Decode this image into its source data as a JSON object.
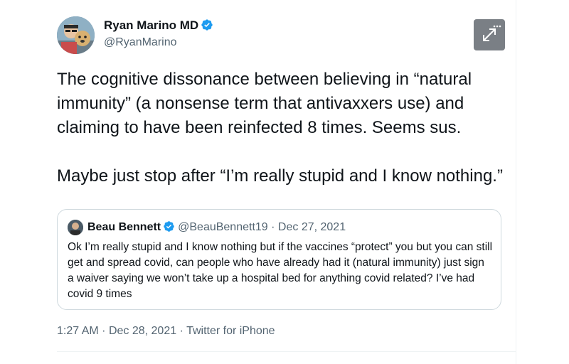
{
  "author": {
    "name": "Ryan Marino MD",
    "handle": "@RyanMarino"
  },
  "tweet": {
    "text": "The cognitive dissonance between believing in “natural immunity” (a nonsense term that antivaxxers use) and claiming to have been reinfected 8 times. Seems sus.\n\nMaybe just stop after “I’m really stupid and I know nothing.”"
  },
  "quoted": {
    "name": "Beau Bennett",
    "handle": "@BeauBennett19",
    "separator": "·",
    "date": "Dec 27, 2021",
    "text": "Ok I’m really stupid and I know nothing but if the vaccines “protect” you but you can still get and spread covid, can people who have already had it (natural immunity) just sign a waiver saying we won’t take up a hospital bed for anything covid related? I’ve had covid 9 times"
  },
  "meta": {
    "time": "1:27 AM",
    "separator": "·",
    "date": "Dec 28, 2021",
    "source": "Twitter for iPhone"
  },
  "icons": {
    "verified": "verified-badge-icon",
    "expand": "expand-icon",
    "more": "more-dots-icon"
  },
  "colors": {
    "verified": "#1d9bf0",
    "secondary_text": "#536471",
    "border": "#cfd9de"
  }
}
